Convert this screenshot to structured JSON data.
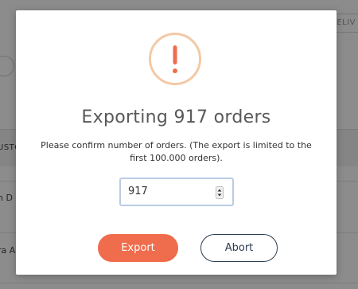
{
  "background": {
    "header_button_label": "DELIV",
    "table_header_label": "USTO",
    "rows": [
      {
        "text": "n D"
      },
      {
        "text": "ra A"
      }
    ]
  },
  "modal": {
    "title": "Exporting 917 orders",
    "message": "Please confirm number of orders. (The export is limited to the first 100.000 orders).",
    "quantity_value": "917",
    "export_label": "Export",
    "abort_label": "Abort",
    "warning_icon": "exclamation-icon",
    "colors": {
      "accent": "#ef6c4c",
      "warning_ring": "#f3c9a6",
      "abort_border": "#2c3e50",
      "input_border": "#b9cce3"
    }
  }
}
